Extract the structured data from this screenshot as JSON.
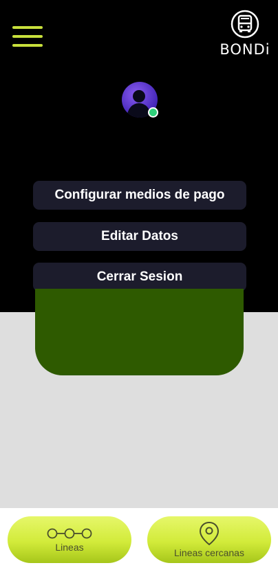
{
  "app": {
    "brand_name": "BONDi"
  },
  "menu": {
    "items": [
      {
        "label": "Configurar medios de pago"
      },
      {
        "label": "Editar Datos"
      },
      {
        "label": "Cerrar Sesion"
      }
    ]
  },
  "bottom_nav": {
    "items": [
      {
        "label": "Lineas",
        "icon": "route-stops-icon"
      },
      {
        "label": "Lineas cercanas",
        "icon": "location-pin-icon"
      }
    ]
  },
  "colors": {
    "accent": "#c8e03c",
    "menu_background": "#000000",
    "menu_button": "#1c1c2c",
    "card_green": "#2e5a00",
    "status_online": "#2fd07a",
    "page_background": "#dedede"
  }
}
